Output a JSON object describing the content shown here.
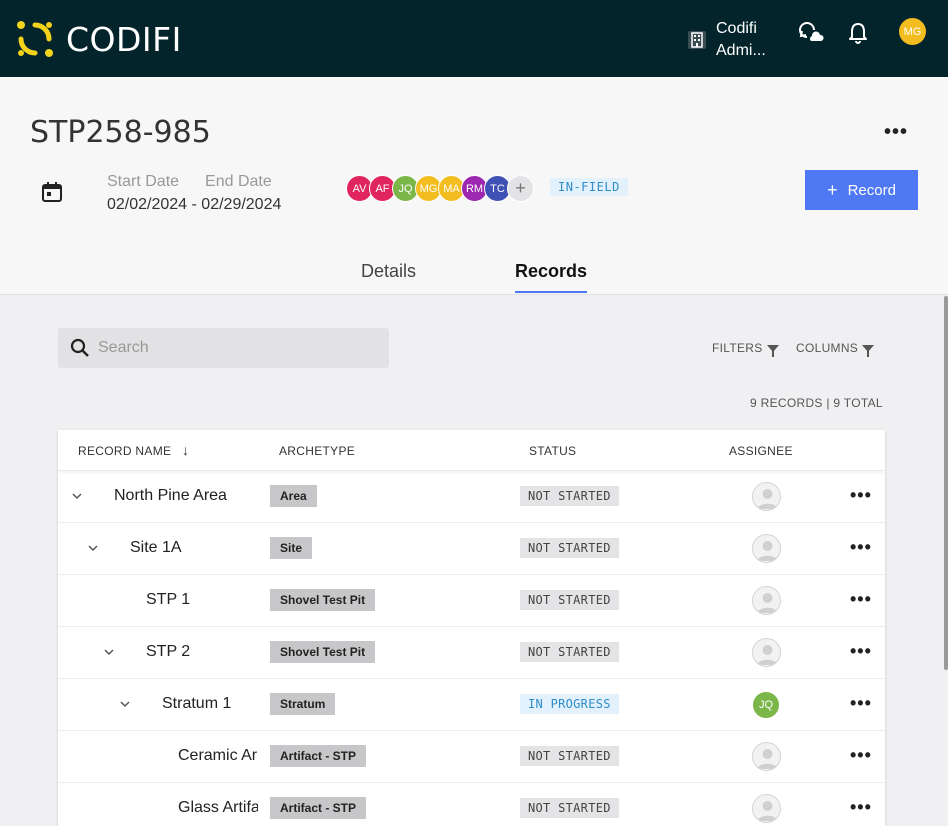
{
  "brand": {
    "name": "CODIFI",
    "accent": "#f3d21a"
  },
  "topbar": {
    "org_line1": "Codifi",
    "org_line2": "Admi...",
    "user_initials": "MG",
    "icons": [
      "building-icon",
      "cloud-sync-icon",
      "bell-icon"
    ]
  },
  "project": {
    "title": "STP258-985",
    "start_label": "Start Date",
    "end_label": "End Date",
    "date_range": "02/02/2024 - 02/29/2024",
    "status": "IN-FIELD",
    "record_button": "Record",
    "record_plus": "+",
    "more": "•••",
    "members": [
      {
        "initials": "AV",
        "color": "#e0245e"
      },
      {
        "initials": "AF",
        "color": "#e0245e"
      },
      {
        "initials": "JQ",
        "color": "#7ab648"
      },
      {
        "initials": "MG",
        "color": "#f3bd20"
      },
      {
        "initials": "MA",
        "color": "#f3bd20"
      },
      {
        "initials": "RM",
        "color": "#9c27b0"
      },
      {
        "initials": "TC",
        "color": "#3f51b5"
      }
    ],
    "add_member": "+"
  },
  "tabs": [
    {
      "label": "Details",
      "active": false
    },
    {
      "label": "Records",
      "active": true
    }
  ],
  "toolbar": {
    "search_placeholder": "Search",
    "filters": "FILTERS",
    "columns": "COLUMNS",
    "count": "9 RECORDS | 9 TOTAL"
  },
  "table": {
    "headers": {
      "name": "RECORD NAME",
      "sort": "↓",
      "archetype": "ARCHETYPE",
      "status": "STATUS",
      "assignee": "ASSIGNEE"
    },
    "rows": [
      {
        "name": "North Pine Area",
        "archetype": "Area",
        "status": "NOT STARTED",
        "assignee": "",
        "expandable": true,
        "depth": 0
      },
      {
        "name": "Site 1A",
        "archetype": "Site",
        "status": "NOT STARTED",
        "assignee": "",
        "expandable": true,
        "depth": 1
      },
      {
        "name": "STP 1",
        "archetype": "Shovel Test Pit",
        "status": "NOT STARTED",
        "assignee": "",
        "expandable": false,
        "depth": 2
      },
      {
        "name": "STP 2",
        "archetype": "Shovel Test Pit",
        "status": "NOT STARTED",
        "assignee": "",
        "expandable": true,
        "depth": 2
      },
      {
        "name": "Stratum 1",
        "archetype": "Stratum",
        "status": "IN PROGRESS",
        "assignee": "JQ",
        "expandable": true,
        "depth": 3
      },
      {
        "name": "Ceramic Ar",
        "archetype": "Artifact - STP",
        "status": "NOT STARTED",
        "assignee": "",
        "expandable": false,
        "depth": 4
      },
      {
        "name": "Glass Artifa",
        "archetype": "Artifact - STP",
        "status": "NOT STARTED",
        "assignee": "",
        "expandable": false,
        "depth": 4
      }
    ],
    "row_more": "•••"
  }
}
